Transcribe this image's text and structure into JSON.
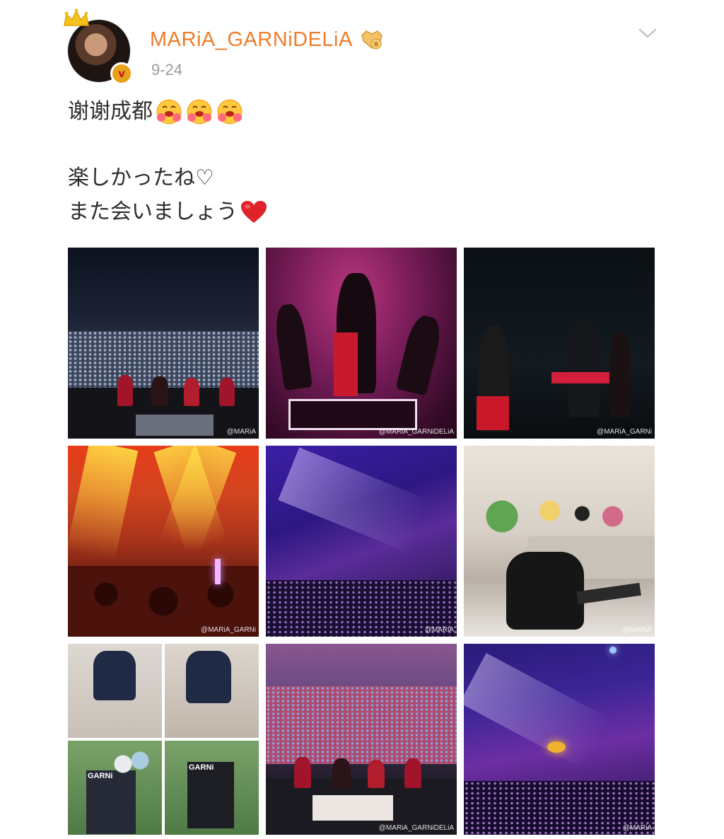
{
  "post": {
    "username": "MARiA_GARNiDELiA",
    "date": "9-24",
    "lines": [
      "谢谢成都",
      "楽しかったね♡",
      "また会いましょう"
    ],
    "emoji": {
      "line1": [
        "hugging-face",
        "hugging-face",
        "hugging-face"
      ],
      "line3": [
        "red-heart"
      ]
    }
  },
  "photos": {
    "watermark_1": "@MARiA",
    "watermark_2": "@MARiA_GARNiDELiA",
    "watermark_3": "@MARiA_GARNi",
    "watermark_4": "@MARiA_GARNi",
    "watermark_5": "@MARiA",
    "watermark_6": "@MARiA",
    "watermark_8": "@MARiA_GARNiDELiA",
    "watermark_9": "@MARiA",
    "banner_text": "GARNi",
    "poster_text": "GARNi"
  },
  "colors": {
    "username": "#ee7d2b",
    "date": "#9b9b9b",
    "text": "#2d2d2d",
    "verified_badge": "#e8a21a",
    "heart": "#e0232b"
  },
  "icons": {
    "crown": "crown-icon",
    "verified": "verified-v-icon",
    "member_badge": "member-badge-icon",
    "menu": "chevron-down-icon"
  }
}
